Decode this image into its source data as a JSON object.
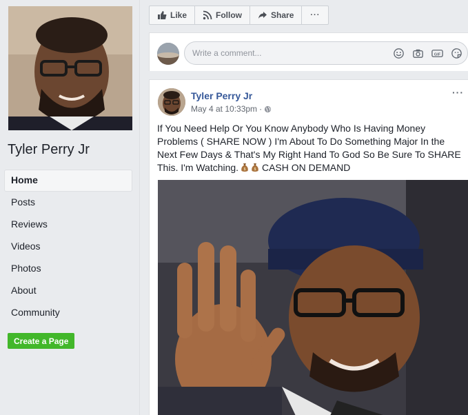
{
  "sidebar": {
    "page_name": "Tyler Perry Jr",
    "nav_items": [
      "Home",
      "Posts",
      "Reviews",
      "Videos",
      "Photos",
      "About",
      "Community"
    ],
    "active_item": "Home",
    "create_page_label": "Create a Page"
  },
  "actions": {
    "like_label": "Like",
    "follow_label": "Follow",
    "share_label": "Share",
    "more_label": "···"
  },
  "comment": {
    "placeholder": "Write a comment...",
    "icons": [
      "emoji-icon",
      "camera-icon",
      "gif-icon",
      "sticker-icon"
    ],
    "gif_label": "GIF"
  },
  "post": {
    "author": "Tyler Perry Jr",
    "timestamp": "May 4 at 10:33pm",
    "separator": "·",
    "more_label": "···",
    "text_before": "If You Need Help Or You Know Anybody Who Is Having Money Problems ( SHARE NOW ) I'm About To Do Something Major In the Next Few Days & That's My Right Hand To God So Be Sure To SHARE This. I'm Watching.",
    "text_after": " CASH ON DEMAND",
    "emoji": "money-bag-icon"
  },
  "colors": {
    "link": "#365899",
    "accent_green": "#42b72a",
    "background": "#e9ebee"
  }
}
